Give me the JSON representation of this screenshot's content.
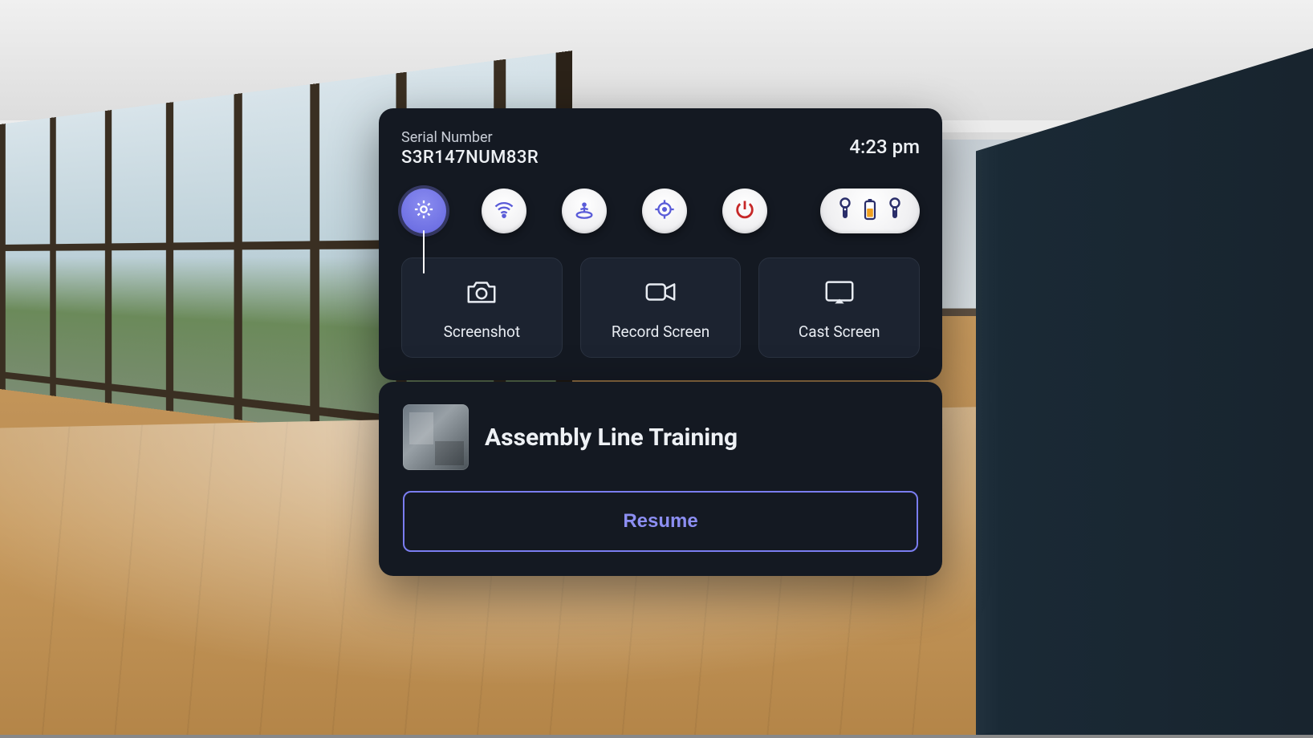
{
  "header": {
    "serial_label": "Serial Number",
    "serial_number": "S3R147NUM83R",
    "time": "4:23 pm"
  },
  "quick_buttons": {
    "settings": "settings",
    "wifi": "wifi",
    "boundary": "boundary",
    "recenter": "recenter",
    "power": "power"
  },
  "colors": {
    "accent": "#7a7df0",
    "danger": "#c62828",
    "battery_warn": "#f0a020"
  },
  "actions": [
    {
      "id": "screenshot",
      "label": "Screenshot"
    },
    {
      "id": "record",
      "label": "Record Screen"
    },
    {
      "id": "cast",
      "label": "Cast Screen"
    }
  ],
  "app": {
    "title": "Assembly Line Training",
    "resume_label": "Resume"
  }
}
